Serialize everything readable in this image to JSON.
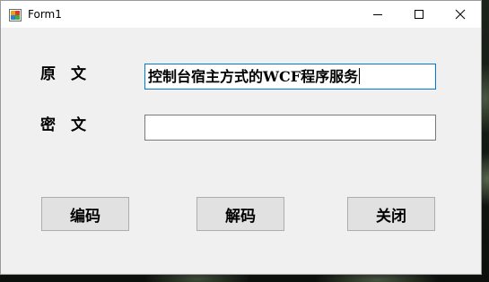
{
  "window": {
    "title": "Form1"
  },
  "titlebar": {
    "icons": [
      "app-icon",
      "minimize-icon",
      "maximize-icon",
      "close-icon"
    ]
  },
  "form": {
    "original_label": "原　文",
    "original_value": "控制台宿主方式的WCF程序服务",
    "cipher_label": "密　文",
    "cipher_value": ""
  },
  "buttons": {
    "encode_label": "编码",
    "decode_label": "解码",
    "close_label": "关闭"
  },
  "colors": {
    "window_bg": "#f0f0f0",
    "titlebar_bg": "#ffffff",
    "focus_border": "#0078d7",
    "button_bg": "#e1e1e1"
  }
}
